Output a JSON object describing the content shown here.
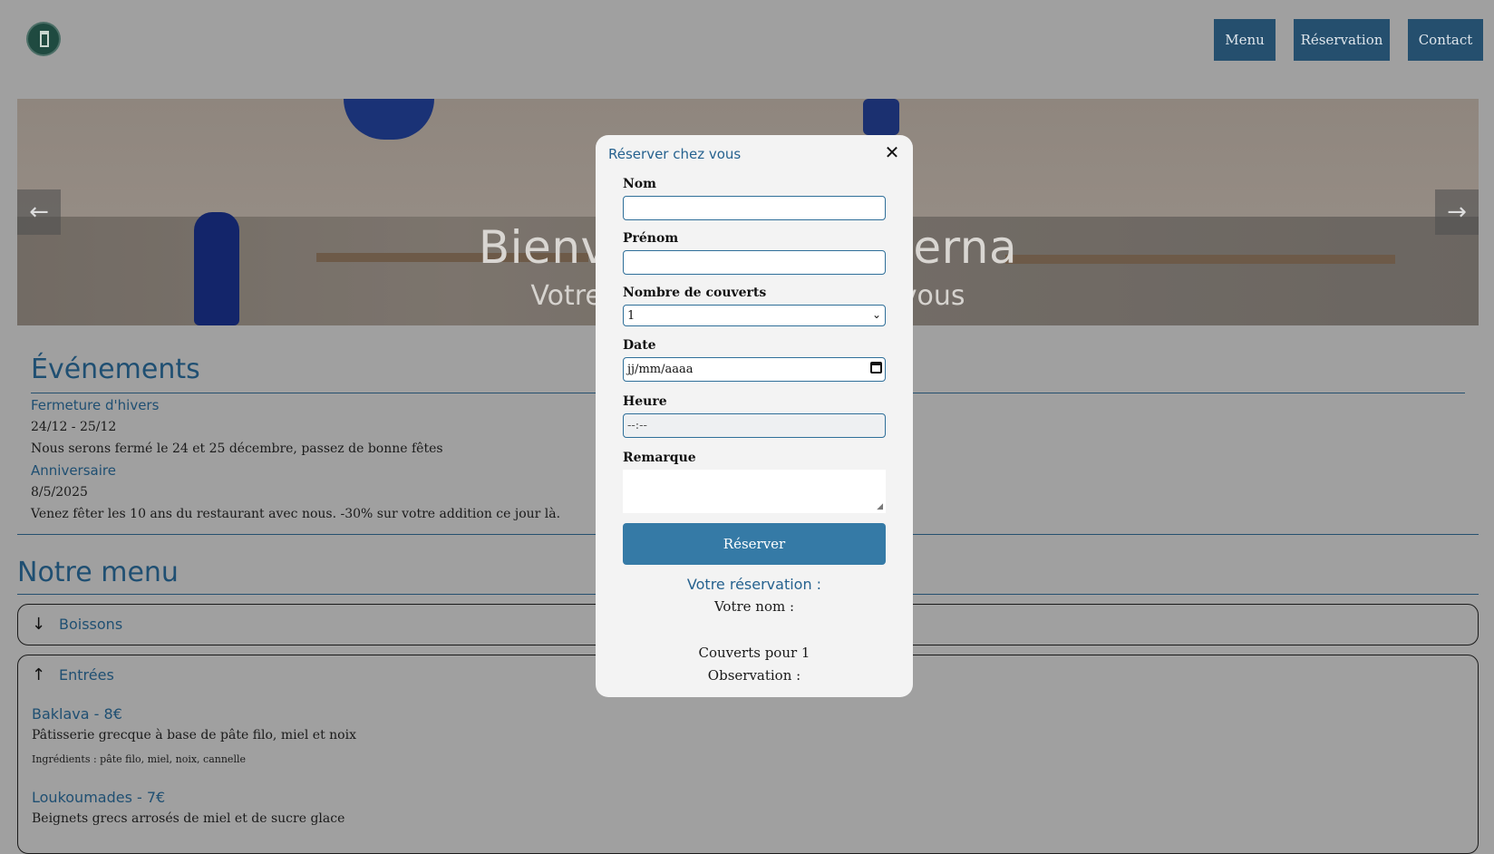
{
  "nav": {
    "menu": "Menu",
    "reservation": "Réservation",
    "contact": "Contact"
  },
  "hero": {
    "title": "Bienvenue à la Taverna",
    "subtitle": "Votre restaurant grec chez vous",
    "prev_icon": "arrow-left",
    "next_icon": "arrow-right"
  },
  "events": {
    "title": "Événements",
    "items": [
      {
        "name": "Fermeture d'hivers",
        "date": "24/12 - 25/12",
        "description": "Nous serons fermé le 24 et 25 décembre, passez de bonne fêtes"
      },
      {
        "name": "Anniversaire",
        "date": "8/5/2025",
        "description": "Venez fêter les 10 ans du restaurant avec nous. -30% sur votre addition ce jour là."
      }
    ]
  },
  "menu": {
    "title": "Notre menu",
    "sections": [
      {
        "label": "Boissons",
        "icon": "arrow-down"
      },
      {
        "label": "Entrées",
        "icon": "arrow-up"
      }
    ],
    "dishes": [
      {
        "name": "Baklava - 8€",
        "description": "Pâtisserie grecque à base de pâte filo, miel et noix",
        "ingredients": "Ingrédients : pâte filo, miel, noix, cannelle"
      },
      {
        "name": "Loukoumades - 7€",
        "description": "Beignets grecs arrosés de miel et de sucre glace"
      }
    ]
  },
  "modal": {
    "title": "Réserver chez vous",
    "close": "✕",
    "fields": {
      "nom_label": "Nom",
      "prenom_label": "Prénom",
      "couverts_label": "Nombre de couverts",
      "couverts_value": "1",
      "date_label": "Date",
      "date_placeholder": "jj/mm/aaaa",
      "heure_label": "Heure",
      "heure_placeholder": "--:--",
      "remarque_label": "Remarque"
    },
    "submit": "Réserver",
    "summary": {
      "title": "Votre réservation :",
      "name_line": "Votre nom :",
      "covers_line": "Couverts pour 1",
      "observation_line": "Observation :"
    }
  }
}
